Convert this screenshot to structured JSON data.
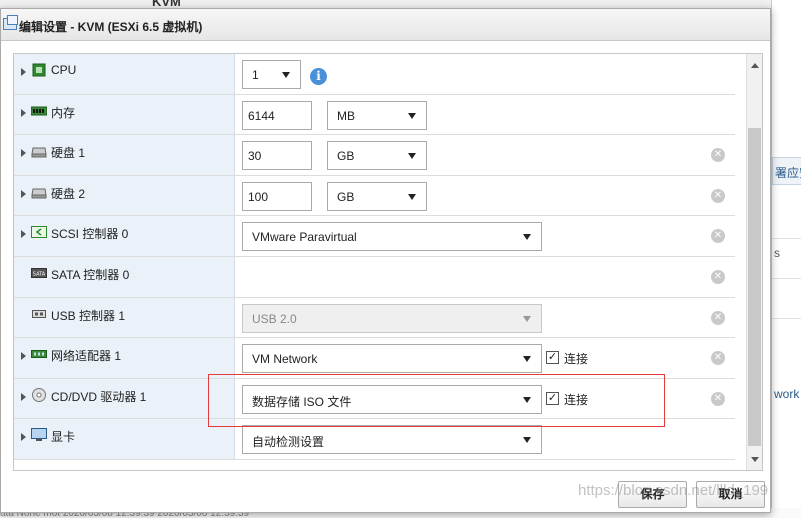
{
  "background": {
    "top_title": "KVM",
    "right_items": [
      "署应安",
      "s",
      "work (视"
    ],
    "bottom_text": "ata          None               mot               2020/03/08 12:39:39            2020/03/08 12:39:39"
  },
  "dialog": {
    "title": "编辑设置 - KVM (ESXi 6.5 虚拟机)",
    "rows": [
      {
        "label": "CPU",
        "icon": "cpu-icon",
        "expandable": true,
        "select": "1",
        "info": "i"
      },
      {
        "label": "内存",
        "icon": "memory-icon",
        "expandable": true,
        "value": "6144",
        "unit": "MB"
      },
      {
        "label": "硬盘 1",
        "icon": "hard-disk-icon",
        "expandable": true,
        "value": "30",
        "unit": "GB",
        "remove": "✕"
      },
      {
        "label": "硬盘 2",
        "icon": "hard-disk-icon",
        "expandable": true,
        "value": "100",
        "unit": "GB",
        "remove": "✕"
      },
      {
        "label": "SCSI 控制器 0",
        "icon": "scsi-controller-icon",
        "expandable": true,
        "select": "VMware Paravirtual",
        "remove": "✕"
      },
      {
        "label": "SATA 控制器 0",
        "icon": "sata-controller-icon",
        "expandable": false,
        "remove": "✕"
      },
      {
        "label": "USB 控制器 1",
        "icon": "usb-icon",
        "expandable": false,
        "select": "USB 2.0",
        "disabled": true,
        "remove": "✕"
      },
      {
        "label": "网络适配器 1",
        "icon": "network-adapter-icon",
        "expandable": true,
        "select": "VM Network",
        "checkbox_label": "连接",
        "checked": true,
        "remove": "✕"
      },
      {
        "label": "CD/DVD 驱动器 1",
        "icon": "cd-dvd-icon",
        "expandable": true,
        "select": "数据存储 ISO 文件",
        "checkbox_label": "连接",
        "checked": true,
        "remove": "✕"
      },
      {
        "label": "显卡",
        "icon": "display-icon",
        "expandable": true,
        "select": "自动检测设置"
      }
    ],
    "save_label": "保存",
    "cancel_label": "取消"
  },
  "watermark": "https://blog.csdn.net/llld_199",
  "colors": {
    "highlight": "#e23b3b",
    "info": "#4a90d9",
    "left_column": "#eaf1f8"
  }
}
